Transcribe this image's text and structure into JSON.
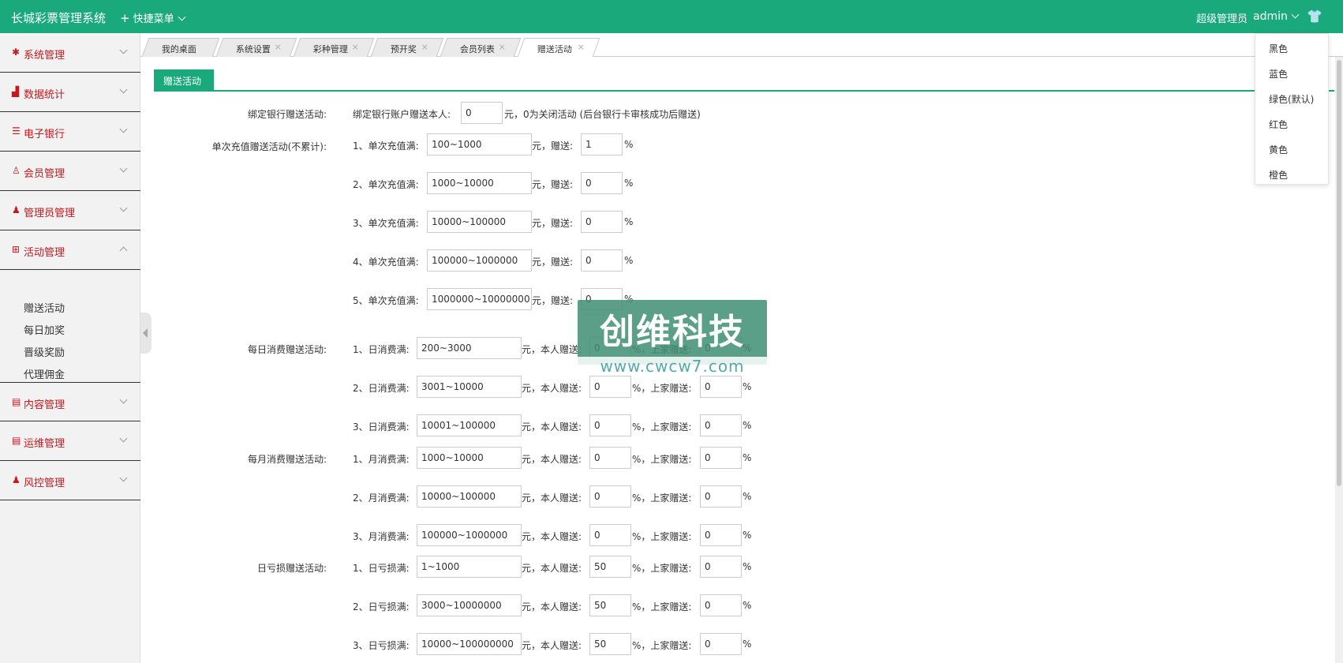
{
  "header": {
    "brand": "长城彩票管理系统",
    "quick_menu": "快捷菜单",
    "role": "超级管理员",
    "user": "admin"
  },
  "sidebar": {
    "items": [
      {
        "label": "系统管理",
        "icon": "gear-icon"
      },
      {
        "label": "数据统计",
        "icon": "chart-icon"
      },
      {
        "label": "电子银行",
        "icon": "list-icon"
      },
      {
        "label": "会员管理",
        "icon": "user-icon"
      },
      {
        "label": "管理员管理",
        "icon": "admin-icon"
      },
      {
        "label": "活动管理",
        "icon": "gift-icon"
      },
      {
        "label": "内容管理",
        "icon": "doc-icon"
      },
      {
        "label": "运维管理",
        "icon": "doc-icon"
      },
      {
        "label": "风控管理",
        "icon": "user-icon"
      }
    ],
    "sub_items": [
      "赠送活动",
      "每日加奖",
      "晋级奖励",
      "代理佣金"
    ]
  },
  "tabs": [
    "我的桌面",
    "系统设置",
    "彩种管理",
    "预开奖",
    "会员列表",
    "赠送活动"
  ],
  "tab_close": "×",
  "dropdown": {
    "options": [
      "黑色",
      "蓝色",
      "绿色(默认)",
      "红色",
      "黄色",
      "橙色"
    ]
  },
  "section_title": "赠送活动",
  "form": {
    "bank": {
      "label": "绑定银行赠送活动:",
      "prefix": "绑定银行账户赠送本人:",
      "value": "0",
      "suffix": "元，0为关闭活动 (后台银行卡审核成功后赠送)"
    },
    "recharge": {
      "label": "单次充值赠送活动(不累计):",
      "rows": [
        {
          "n": "1、单次充值满:",
          "range": "100~1000",
          "pct": "1"
        },
        {
          "n": "2、单次充值满:",
          "range": "1000~10000",
          "pct": "0"
        },
        {
          "n": "3、单次充值满:",
          "range": "10000~100000",
          "pct": "0"
        },
        {
          "n": "4、单次充值满:",
          "range": "100000~1000000",
          "pct": "0"
        },
        {
          "n": "5、单次充值满:",
          "range": "1000000~10000000",
          "pct": "0"
        }
      ]
    },
    "daily": {
      "label": "每日消费赠送活动:",
      "rows": [
        {
          "n": "1、日消费满:",
          "range": "200~3000",
          "self": "0",
          "parent": "0"
        },
        {
          "n": "2、日消费满:",
          "range": "3001~10000",
          "self": "0",
          "parent": "0"
        },
        {
          "n": "3、日消费满:",
          "range": "10001~100000",
          "self": "0",
          "parent": "0"
        }
      ]
    },
    "monthly": {
      "label": "每月消费赠送活动:",
      "rows": [
        {
          "n": "1、月消费满:",
          "range": "1000~10000",
          "self": "0",
          "parent": "0"
        },
        {
          "n": "2、月消费满:",
          "range": "10000~100000",
          "self": "0",
          "parent": "0"
        },
        {
          "n": "3、月消费满:",
          "range": "100000~1000000",
          "self": "0",
          "parent": "0"
        }
      ]
    },
    "loss": {
      "label": "日亏损赠送活动:",
      "rows": [
        {
          "n": "1、日亏损满:",
          "range": "1~1000",
          "self": "50",
          "parent": "0"
        },
        {
          "n": "2、日亏损满:",
          "range": "3000~10000000",
          "self": "50",
          "parent": "0"
        },
        {
          "n": "3、日亏损满:",
          "range": "10000~100000000",
          "self": "50",
          "parent": "0"
        }
      ]
    },
    "yuan_gift": "元，赠送:",
    "yuan_self": "元，本人赠送:",
    "pct_parent": "%，上家赠送:",
    "pct": "%"
  },
  "watermark": {
    "text": "创维科技",
    "url": "www.cwcw7.com"
  }
}
